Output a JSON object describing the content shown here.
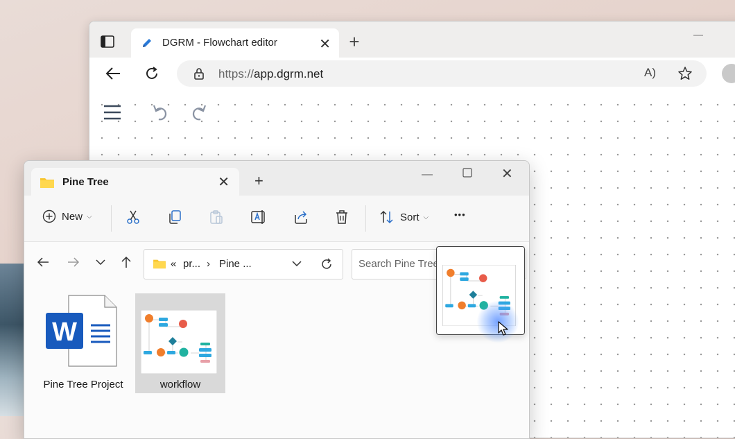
{
  "browser": {
    "tab_title": "DGRM - Flowchart editor",
    "new_tab_label": "+",
    "tab_close": "✕",
    "url_protocol": "https://",
    "url_host": "app.dgrm.net",
    "read_aloud": "A)"
  },
  "explorer": {
    "tab_title": "Pine Tree",
    "tab_close": "✕",
    "new_tab_label": "+",
    "close_label": "✕",
    "commands": {
      "new_label": "New",
      "sort_label": "Sort",
      "more_label": "•••"
    },
    "breadcrumb": {
      "overflow": "«",
      "segment1": "pr...",
      "separator": "›",
      "segment2": "Pine ..."
    },
    "search_placeholder": "Search Pine Tree",
    "files": [
      {
        "name": "Pine Tree Project",
        "type": "word-document"
      },
      {
        "name": "workflow",
        "type": "image",
        "selected": true
      }
    ]
  },
  "colors": {
    "word_blue": "#185abd",
    "flow_orange": "#f07e2c",
    "flow_blue": "#2ea8e0",
    "flow_teal": "#20b2a0",
    "flow_red": "#e85c4a",
    "folder_yellow": "#f8c630"
  }
}
